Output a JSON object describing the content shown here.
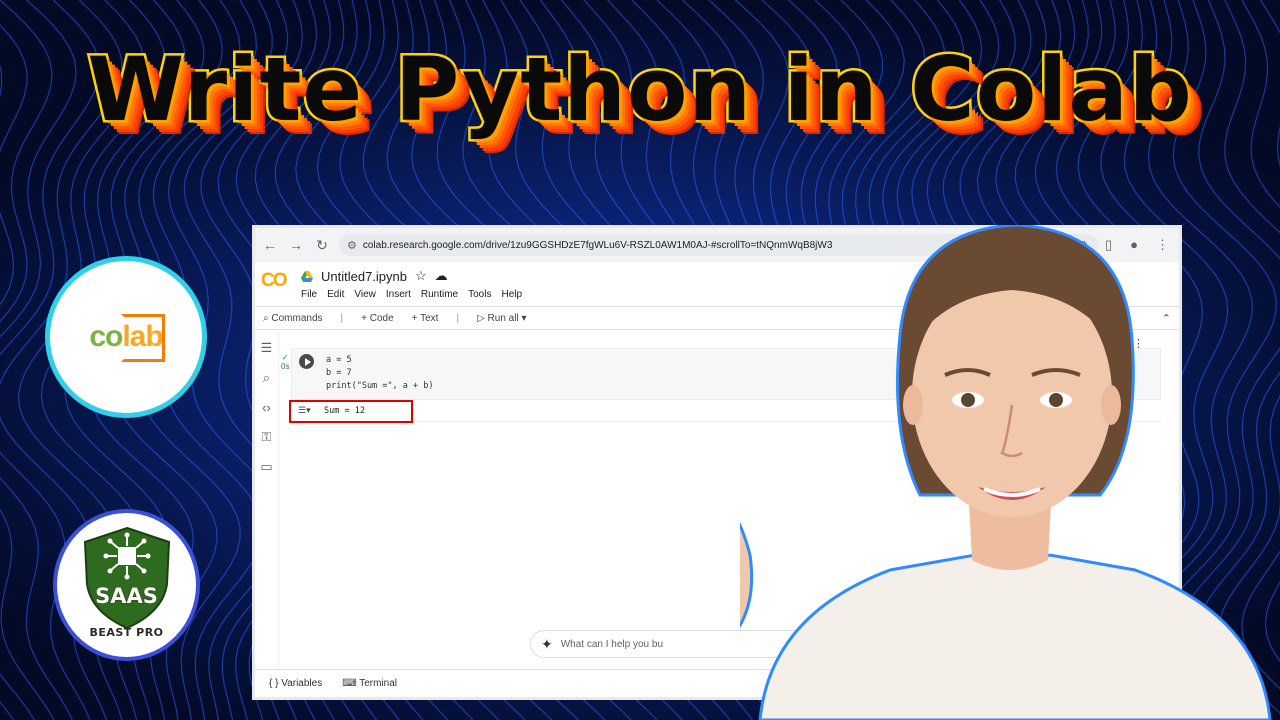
{
  "headline": "Write Python in Colab",
  "logos": {
    "colab": {
      "c1": "co",
      "c2": "lab"
    },
    "saas": {
      "name": "SAAS",
      "sub": "BEAST PRO"
    }
  },
  "browser": {
    "url": "colab.research.google.com/drive/1zu9GGSHDzE7fgWLu6V-RSZL0AW1M0AJ-#scrollTo=tNQnmWqB8jW3",
    "nav_icons": [
      "back-icon",
      "forward-icon",
      "reload-icon"
    ]
  },
  "colab": {
    "logo": "CO",
    "notebook_title": "Untitled7.ipynb",
    "menu": [
      "File",
      "Edit",
      "View",
      "Insert",
      "Runtime",
      "Tools",
      "Help"
    ],
    "toolbar": {
      "commands": "Commands",
      "code": "+ Code",
      "text": "+ Text",
      "run_all": "Run all"
    },
    "cell": {
      "status": "0s",
      "code": "a = 5\nb = 7\nprint(\"Sum =\", a + b)"
    },
    "output": "Sum = 12",
    "gemini_placeholder": "What can I help you bu",
    "status_bar": {
      "variables": "Variables",
      "terminal": "Terminal"
    }
  },
  "colors": {
    "headline_fill": "#0a0a0a",
    "headline_stroke": "#ffd400",
    "highlight_box": "#e00000",
    "colab_orange": "#f9ab00"
  }
}
